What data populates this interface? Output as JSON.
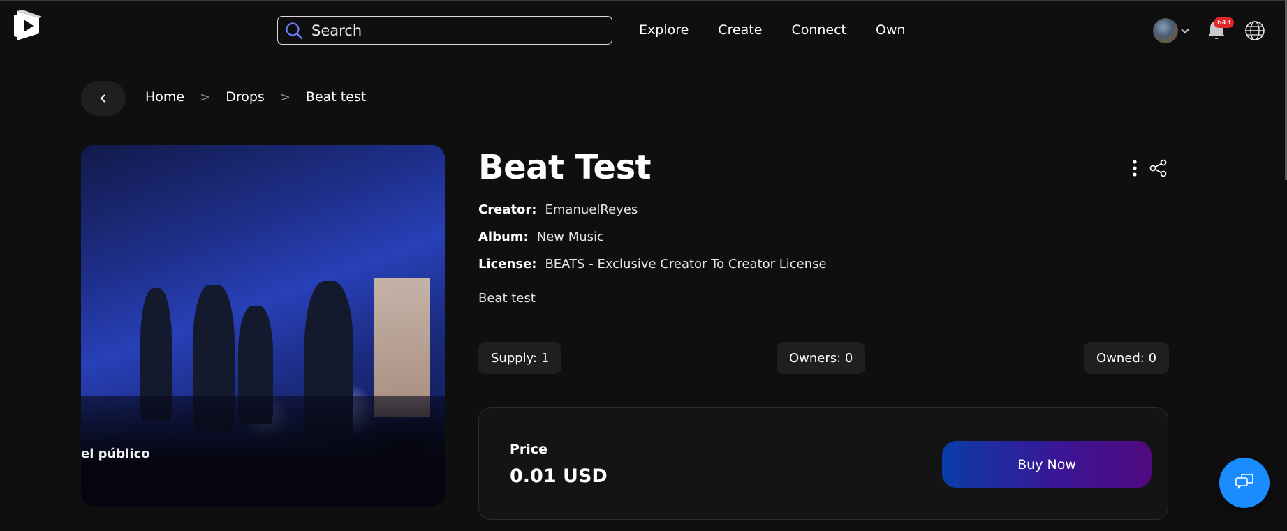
{
  "header": {
    "search_placeholder": "Search",
    "nav": [
      "Explore",
      "Create",
      "Connect",
      "Own"
    ],
    "notification_count": "643"
  },
  "breadcrumb": {
    "items": [
      "Home",
      "Drops",
      "Beat test"
    ],
    "separator": ">"
  },
  "media": {
    "caption": "el público"
  },
  "item": {
    "title": "Beat Test",
    "creator_label": "Creator:",
    "creator": "EmanuelReyes",
    "album_label": "Album:",
    "album": "New Music",
    "license_label": "License:",
    "license": "BEATS - Exclusive Creator To Creator License",
    "description": "Beat test"
  },
  "stats": {
    "supply": "Supply: 1",
    "owners": "Owners: 0",
    "owned": "Owned: 0"
  },
  "purchase": {
    "price_label": "Price",
    "price": "0.01 USD",
    "buy_label": "Buy Now"
  },
  "colors": {
    "background": "#0f0f10",
    "accent_blue": "#1a8cff",
    "buy_gradient_start": "#0a3da8",
    "buy_gradient_end": "#520a80",
    "badge": "#e0262a"
  },
  "icons": {
    "logo": "play-logo-icon",
    "search": "search-icon",
    "chevron": "chevron-down-icon",
    "bell": "bell-icon",
    "globe": "globe-icon",
    "back": "chevron-left-icon",
    "more": "kebab-icon",
    "share": "share-icon",
    "chat": "chat-icon"
  }
}
